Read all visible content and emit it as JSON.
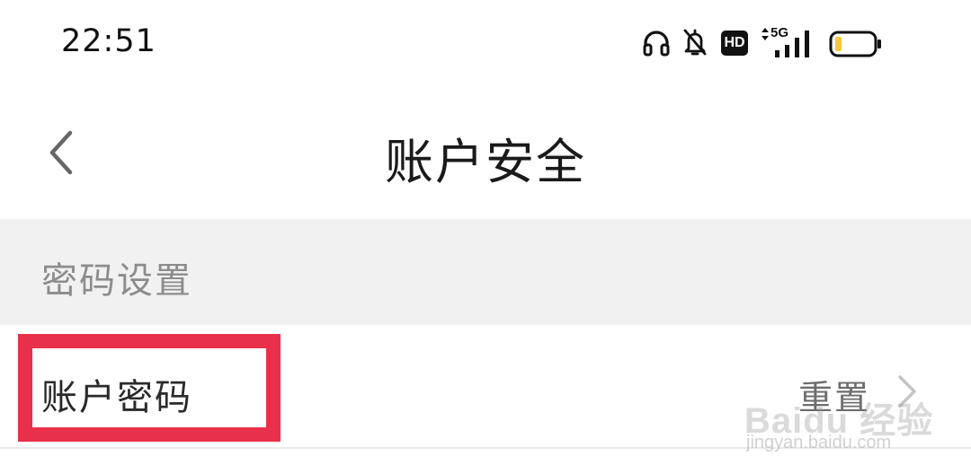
{
  "status_bar": {
    "time": "22:51",
    "icons": [
      "headset-icon",
      "mute-bell-icon",
      "hd-icon",
      "5g-signal-icon",
      "battery-icon"
    ],
    "hd_label": "HD",
    "network_label": "5G",
    "battery_color": "#f5c842"
  },
  "nav": {
    "title": "账户安全",
    "back_icon": "chevron-left-icon"
  },
  "section": {
    "label": "密码设置"
  },
  "rows": [
    {
      "label": "账户密码",
      "action": "重置",
      "chevron_icon": "chevron-right-icon"
    }
  ],
  "annotation": {
    "color": "#e8304a"
  },
  "watermark": {
    "logo": "Baidu 经验",
    "url": "jingyan.baidu.com"
  }
}
